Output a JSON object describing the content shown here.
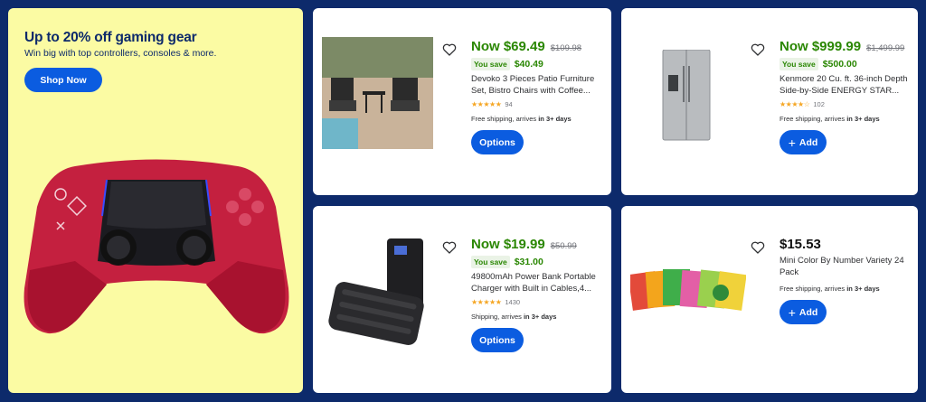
{
  "promo": {
    "title": "Up to 20% off gaming gear",
    "subtitle": "Win big with top controllers, consoles & more.",
    "button": "Shop Now",
    "image": "red-game-controller"
  },
  "products": [
    {
      "price_now": "Now $69.49",
      "price_was": "$109.98",
      "you_save_label": "You save",
      "you_save": "$40.49",
      "title_line1": "Devoko 3 Pieces Patio Furniture",
      "title_line2": "Set, Bistro Chairs with Coffee...",
      "stars": "★★★★★",
      "rating": 4.5,
      "rating_count": "94",
      "shipping_text": "Free shipping, arrives",
      "shipping_days": "in 3+ days",
      "button": "Options",
      "image": "patio-furniture-set"
    },
    {
      "price_now": "Now $999.99",
      "price_was": "$1,499.99",
      "you_save_label": "You save",
      "you_save": "$500.00",
      "title_line1": "Kenmore 20 Cu. ft. 36-inch Depth",
      "title_line2": "Side-by-Side ENERGY STAR...",
      "stars": "★★★★☆",
      "rating": 4,
      "rating_count": "102",
      "shipping_text": "Free shipping, arrives",
      "shipping_days": "in 3+ days",
      "button": "Add",
      "image": "stainless-refrigerator"
    },
    {
      "price_now": "Now $19.99",
      "price_was": "$50.99",
      "you_save_label": "You save",
      "you_save": "$31.00",
      "title_line1": "49800mAh Power Bank Portable",
      "title_line2": "Charger with Built in Cables,4...",
      "stars": "★★★★★",
      "rating": 4.5,
      "rating_count": "1430",
      "shipping_text": "Shipping, arrives",
      "shipping_days": "in 3+ days",
      "button": "Options",
      "image": "power-bank"
    },
    {
      "price_now": "$15.53",
      "title_line1": "Mini Color By Number Variety 24",
      "title_line2": "Pack",
      "shipping_text": "Free shipping, arrives",
      "shipping_days": "in 3+ days",
      "button": "Add",
      "image": "color-by-number-books"
    }
  ],
  "colors": {
    "background": "#0d2a6b",
    "promo_bg": "#fbfba3",
    "accent": "#0b5ce0",
    "price_green": "#2a8703",
    "star": "#f5a623"
  }
}
